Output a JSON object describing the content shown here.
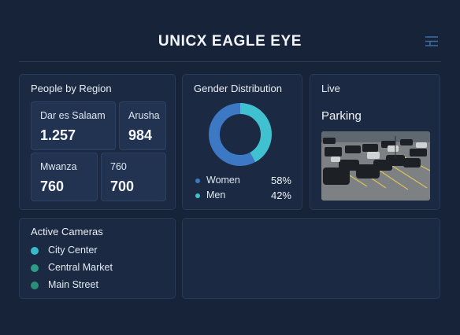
{
  "header": {
    "title": "UNICX EAGLE EYE"
  },
  "region": {
    "title": "People by Region",
    "tiles": [
      {
        "name": "Dar es Salaam",
        "value": "1.257"
      },
      {
        "name": "Arusha",
        "value": "984"
      },
      {
        "name": "Mwanza",
        "value": "760"
      },
      {
        "name": "760",
        "value": "700"
      }
    ]
  },
  "gender": {
    "title": "Gender Distribution",
    "items": [
      {
        "label": "Women",
        "value": "58%",
        "fraction": 0.58,
        "color": "#3d78c4"
      },
      {
        "label": "Men",
        "value": "42%",
        "fraction": 0.42,
        "color": "#3fc1cf"
      }
    ]
  },
  "live": {
    "title": "Live",
    "camera": "Parking"
  },
  "cameras": {
    "title": "Active Cameras",
    "items": [
      {
        "label": "City Center",
        "color": "#38bccc"
      },
      {
        "label": "Central Market",
        "color": "#2e9c86"
      },
      {
        "label": "Main Street",
        "color": "#2a8f78"
      }
    ]
  },
  "icons": {
    "menu": "menu-icon"
  },
  "colors": {
    "background": "#172338",
    "card": "#1b2a42",
    "accent": "#3fc1cf"
  }
}
